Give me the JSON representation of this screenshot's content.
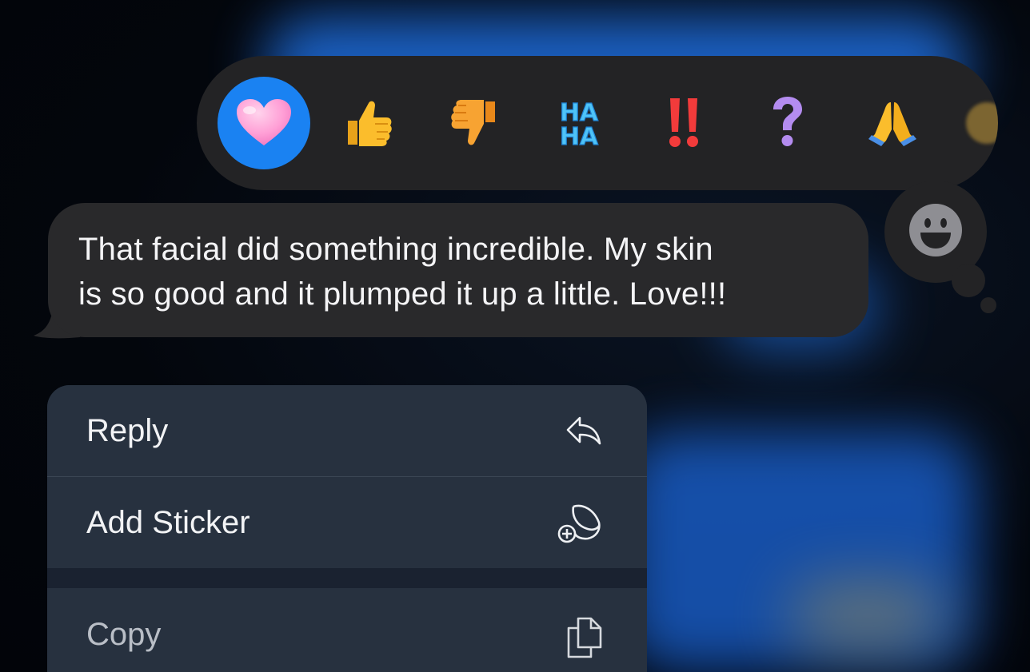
{
  "tapback": {
    "reactions": [
      {
        "name": "heart",
        "icon": "pink-heart-icon",
        "selected": true
      },
      {
        "name": "thumbs-up",
        "icon": "thumbs-up-icon",
        "selected": false
      },
      {
        "name": "thumbs-down",
        "icon": "thumbs-down-icon",
        "selected": false
      },
      {
        "name": "haha",
        "icon": "haha-icon",
        "label": "HA HA",
        "selected": false
      },
      {
        "name": "emphasis",
        "icon": "double-exclamation-icon",
        "selected": false
      },
      {
        "name": "question",
        "icon": "question-mark-icon",
        "selected": false
      },
      {
        "name": "pray",
        "icon": "folded-hands-icon",
        "selected": false
      }
    ],
    "emoji_button_icon": "smiley-face-icon",
    "selected_color": "#1a82f2"
  },
  "message": {
    "text_line1": "That facial did something incredible. My skin",
    "text_line2": "is so good and it plumped it up a little. Love!!!"
  },
  "menu": {
    "items": [
      {
        "label": "Reply",
        "icon": "reply-arrow-icon"
      },
      {
        "label": "Add Sticker",
        "icon": "add-sticker-icon"
      },
      {
        "label": "Copy",
        "icon": "copy-icon"
      }
    ]
  }
}
